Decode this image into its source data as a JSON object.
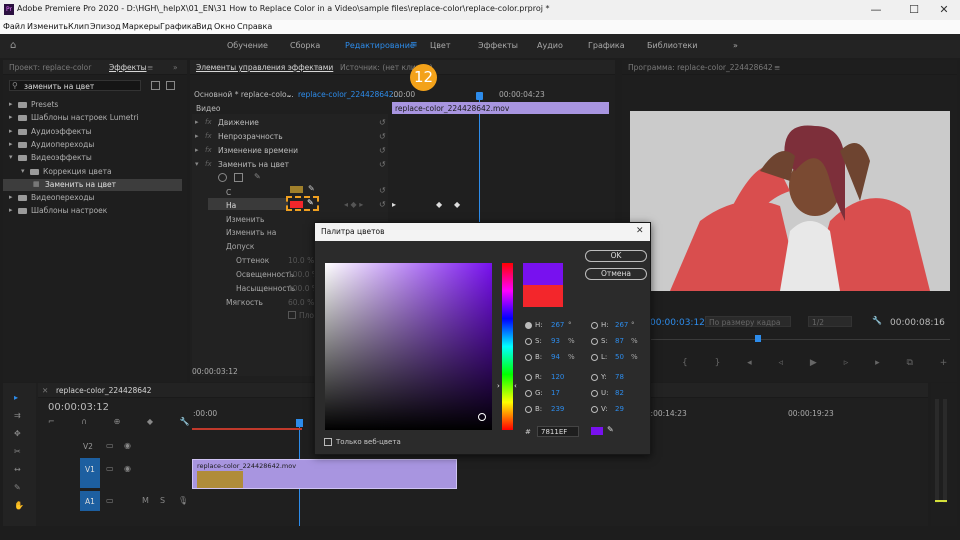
{
  "window": {
    "icon": "Pr",
    "title": "Adobe Premiere Pro 2020 - D:\\HGH\\_helpX\\01_EN\\31 How to Replace Color in a Video\\sample files\\replace-color\\replace-color.prproj *",
    "minimize": "—",
    "maximize": "☐",
    "close": "✕"
  },
  "menu": [
    "Файл",
    "Изменить",
    "Клип",
    "Эпизод",
    "Маркеры",
    "Графика",
    "Вид",
    "Окно",
    "Справка"
  ],
  "workspaces": {
    "items": [
      "Обучение",
      "Сборка",
      "Редактирование",
      "Цвет",
      "Эффекты",
      "Аудио",
      "Графика",
      "Библиотеки"
    ],
    "active": "Редактирование",
    "more": "»"
  },
  "project_panel": {
    "tabs": [
      "Проект: replace-color",
      "Эффекты"
    ],
    "search_value": "заменить на цвет",
    "tree": [
      {
        "label": "Presets",
        "level": 0,
        "open": false
      },
      {
        "label": "Шаблоны настроек Lumetri",
        "level": 0,
        "open": false
      },
      {
        "label": "Аудиоэффекты",
        "level": 0,
        "open": false
      },
      {
        "label": "Аудиопереходы",
        "level": 0,
        "open": false
      },
      {
        "label": "Видеоэффекты",
        "level": 0,
        "open": true
      },
      {
        "label": "Коррекция цвета",
        "level": 1,
        "open": true
      },
      {
        "label": "Заменить на цвет",
        "level": 2,
        "selected": true
      },
      {
        "label": "Видеопереходы",
        "level": 0,
        "open": false
      },
      {
        "label": "Шаблоны настроек",
        "level": 0,
        "open": false
      }
    ]
  },
  "effect_controls": {
    "tabs": [
      "Элементы управления эффектами",
      "Источник: (нет клипов)"
    ],
    "source_dropdown": "Основной * replace-colo...",
    "clip_link": "replace-color_224428642...",
    "section": "Видео",
    "effects": [
      {
        "label": "Движение"
      },
      {
        "label": "Непрозрачность"
      },
      {
        "label": "Изменение времени"
      },
      {
        "label": "Заменить на цвет"
      }
    ],
    "params": {
      "from": "С",
      "to": "На",
      "replace": "Изменить",
      "replace_to": "Изменить на",
      "tolerance": "Допуск",
      "hue": "Оттенок",
      "hue_val": "10.0 %",
      "lightness": "Освещенность",
      "lightness_val": "100.0 %",
      "saturation": "Насыщенность",
      "saturation_val": "100.0 %",
      "softness": "Мягкость",
      "softness_val": "60.0 %",
      "solid": "Плоск"
    },
    "timecode": "00:00:03:12",
    "ruler_start": ":00:00",
    "ruler_end": "00:00:04:23",
    "clip_bar": "replace-color_224428642.mov"
  },
  "step_badge": "12",
  "program_monitor": {
    "tab": "Программа: replace-color_224428642",
    "timecode_left": "00:00:03:12",
    "fit": "По размеру кадра",
    "quality": "1/2",
    "timecode_right": "00:00:08:16"
  },
  "timeline": {
    "tab": "replace-color_224428642",
    "timecode": "00:00:03:12",
    "ruler": [
      ":00:00",
      "00:00:14:23",
      "00:00:19:23"
    ],
    "tracks": [
      "V2",
      "V1",
      "A1"
    ],
    "clip": "replace-color_224428642.mov"
  },
  "color_dialog": {
    "title": "Палитра цветов",
    "ok": "OK",
    "cancel": "Отмена",
    "web_only": "Только веб-цвета",
    "new_color": "#7811EF",
    "old_color": "#F3262B",
    "fields_left": [
      {
        "label": "H:",
        "value": "267",
        "unit": "°"
      },
      {
        "label": "S:",
        "value": "93",
        "unit": "%"
      },
      {
        "label": "B:",
        "value": "94",
        "unit": "%"
      },
      {
        "label": "R:",
        "value": "120",
        "unit": ""
      },
      {
        "label": "G:",
        "value": "17",
        "unit": ""
      },
      {
        "label": "B:",
        "value": "239",
        "unit": ""
      }
    ],
    "fields_right": [
      {
        "label": "H:",
        "value": "267",
        "unit": "°"
      },
      {
        "label": "S:",
        "value": "87",
        "unit": "%"
      },
      {
        "label": "L:",
        "value": "50",
        "unit": "%"
      },
      {
        "label": "Y:",
        "value": "78",
        "unit": ""
      },
      {
        "label": "U:",
        "value": "82",
        "unit": ""
      },
      {
        "label": "V:",
        "value": "29",
        "unit": ""
      }
    ],
    "hex_label": "#",
    "hex_value": "7811EF"
  }
}
